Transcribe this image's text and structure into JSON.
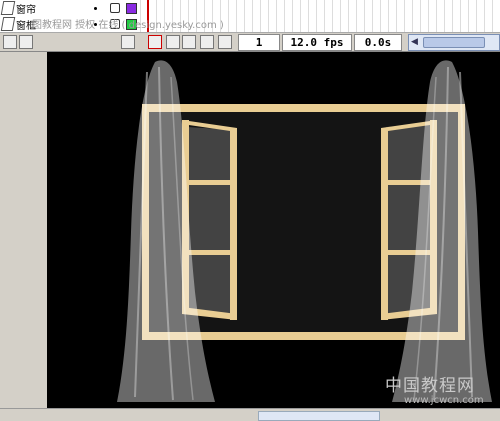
{
  "layers": [
    {
      "name": "窗帘",
      "color": "#8a2be2"
    },
    {
      "name": "窗框",
      "color": "#22cc44"
    }
  ],
  "watermark": "图教程网  授权  在线 ( design.yesky.com )",
  "timeline": {
    "frame": "1",
    "fps": "12.0 fps",
    "time": "0.0s"
  },
  "icons": [
    "layer-icon",
    "lock-icon",
    "trash-icon",
    "onion-skin-icon",
    "edit-multiple-icon",
    "modify-markers-icon",
    "center-frame-icon",
    "scroll-left-icon"
  ],
  "stage": {
    "background": "#000000",
    "frame_color": "#e8c98a",
    "pane_color": "#333333",
    "curtain_color": "#ffffff"
  },
  "brand": {
    "name": "中国教程网",
    "url": "www.jcwcn.com"
  }
}
